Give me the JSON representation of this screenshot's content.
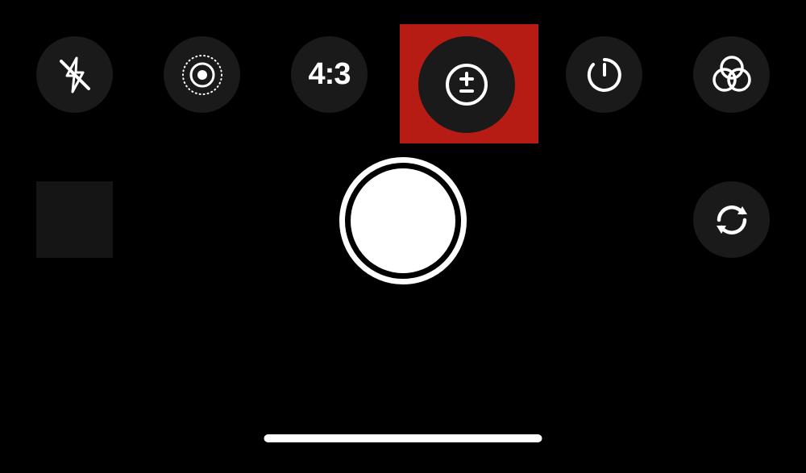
{
  "toolbar": {
    "flash": {
      "icon": "flash-off-icon"
    },
    "live": {
      "icon": "live-photo-icon"
    },
    "ratio": {
      "label": "4:3"
    },
    "exposure": {
      "icon": "exposure-icon",
      "highlighted": true
    },
    "timer": {
      "icon": "timer-icon"
    },
    "filters": {
      "icon": "filters-icon"
    }
  },
  "controls": {
    "thumbnail": {
      "icon": "thumbnail-placeholder"
    },
    "shutter": {
      "icon": "shutter-button"
    },
    "switch": {
      "icon": "camera-switch-icon"
    }
  }
}
